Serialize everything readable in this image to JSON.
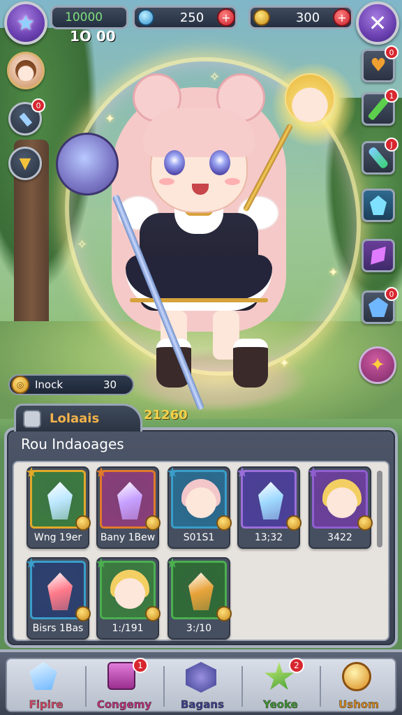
{
  "hud": {
    "player_score": "10000",
    "player_sub_score": "1O 00",
    "currency_blue": "250",
    "currency_gold": "300",
    "menu_icon": "star-icon",
    "close_icon": "close-icon"
  },
  "left_side": {
    "avatar": "avatar-icon",
    "buttons": [
      {
        "name": "sword-icon",
        "badge": "0"
      },
      {
        "name": "arrow-down-icon"
      }
    ]
  },
  "right_side": {
    "buttons": [
      {
        "name": "heart-icon",
        "badge": "0"
      },
      {
        "name": "sword-green-icon",
        "badge": "1"
      },
      {
        "name": "potion-icon",
        "badge": "J"
      },
      {
        "name": "crystal-grid-icon"
      },
      {
        "name": "gem-purple-icon"
      },
      {
        "name": "gem-blue-icon",
        "badge": "0"
      },
      {
        "name": "compass-icon"
      }
    ]
  },
  "mock_bar": {
    "label": "Inock",
    "value": "30"
  },
  "panel": {
    "tab_label": "Lolaais",
    "tab_value": "21260",
    "heading": "Rou Indaoages",
    "cards": [
      {
        "label": "Wng 19er",
        "frame": "#e3a929",
        "bg": "#3b7b3f",
        "kind": "crystal",
        "crystal": "#bde8ff"
      },
      {
        "label": "Bany 1Bew",
        "frame": "#e07b2a",
        "bg": "#8a3d7a",
        "kind": "crystal",
        "crystal": "#c7a0ff"
      },
      {
        "label": "S01S1",
        "frame": "#3a9ec9",
        "bg": "#2b6b8f",
        "kind": "portrait",
        "hair": "#f3c7c9"
      },
      {
        "label": "13;32",
        "frame": "#9b6fd9",
        "bg": "#4b3f9a",
        "kind": "crystal",
        "crystal": "#9fd9ff"
      },
      {
        "label": "3422",
        "frame": "#8f5fd0",
        "bg": "#6b3f9a",
        "kind": "portrait",
        "hair": "#f3cf63"
      },
      {
        "label": "Bisrs 1Bas",
        "frame": "#3a9ec9",
        "bg": "#2b3f6f",
        "kind": "crystal",
        "crystal": "#ff7a8a"
      },
      {
        "label": "1:/191",
        "frame": "#4caf50",
        "bg": "#3b7b3f",
        "kind": "portrait",
        "hair": "#f3cf63"
      },
      {
        "label": "3:/10",
        "frame": "#4caf50",
        "bg": "#2f6b35",
        "kind": "crystal",
        "crystal": "#e8a33a"
      }
    ]
  },
  "bottom_nav": [
    {
      "label": "Fipire",
      "color": "#e04a6a",
      "icon": "crystal-icon",
      "badge": ""
    },
    {
      "label": "Congemy",
      "color": "#c0307e",
      "icon": "shop-icon",
      "badge": "1"
    },
    {
      "label": "Bagans",
      "color": "#3b3f8f",
      "icon": "bag-icon",
      "badge": ""
    },
    {
      "label": "Yeoke",
      "color": "#3f9a2f",
      "icon": "star-icon",
      "badge": "2"
    },
    {
      "label": "Ushom",
      "color": "#d98a1a",
      "icon": "orb-icon",
      "badge": ""
    }
  ]
}
